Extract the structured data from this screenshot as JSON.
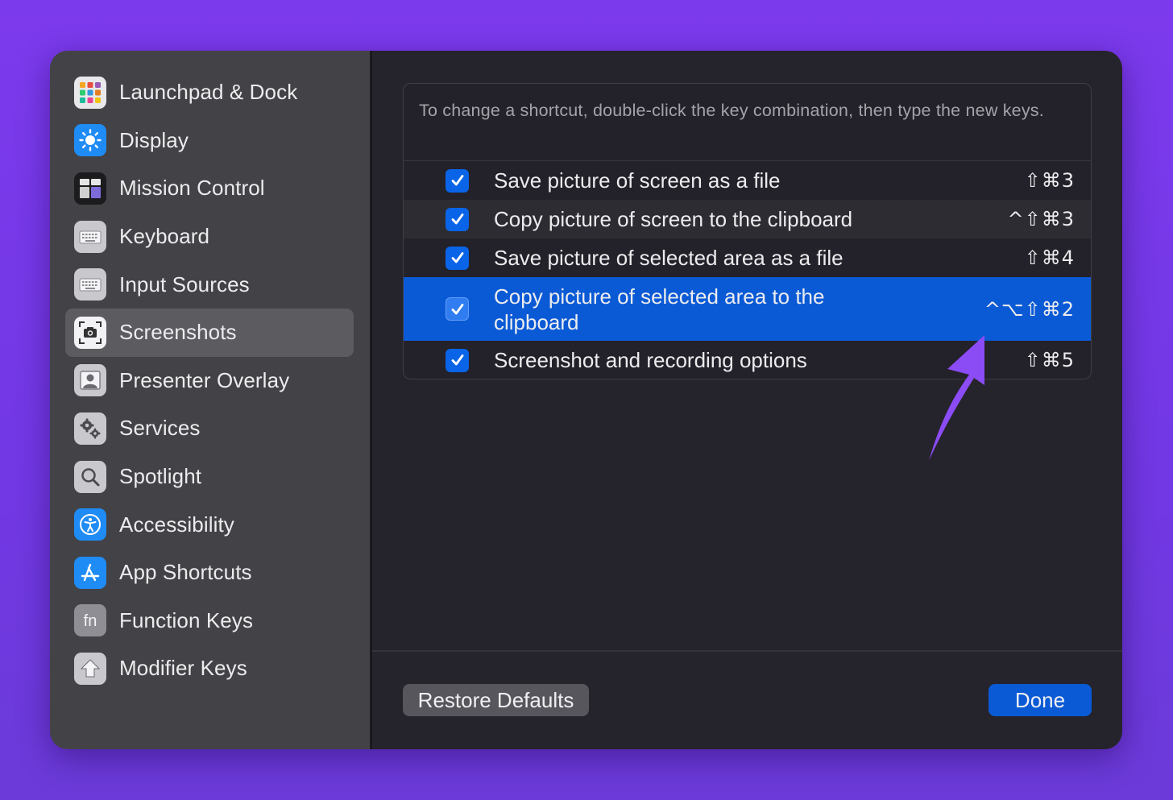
{
  "sidebar": {
    "items": [
      {
        "label": "Launchpad & Dock",
        "icon": "launchpad-icon"
      },
      {
        "label": "Display",
        "icon": "display-brightness-icon"
      },
      {
        "label": "Mission Control",
        "icon": "mission-control-icon"
      },
      {
        "label": "Keyboard",
        "icon": "keyboard-icon"
      },
      {
        "label": "Input Sources",
        "icon": "input-sources-icon"
      },
      {
        "label": "Screenshots",
        "icon": "screenshot-camera-icon",
        "selected": true
      },
      {
        "label": "Presenter Overlay",
        "icon": "presenter-overlay-icon"
      },
      {
        "label": "Services",
        "icon": "services-gears-icon"
      },
      {
        "label": "Spotlight",
        "icon": "spotlight-search-icon"
      },
      {
        "label": "Accessibility",
        "icon": "accessibility-icon"
      },
      {
        "label": "App Shortcuts",
        "icon": "app-shortcuts-icon"
      },
      {
        "label": "Function Keys",
        "icon": "function-keys-icon"
      },
      {
        "label": "Modifier Keys",
        "icon": "modifier-keys-icon"
      }
    ]
  },
  "panel": {
    "hint": "To change a shortcut, double-click the key combination, then type the new keys.",
    "shortcuts": [
      {
        "label": "Save picture of screen as a file",
        "keys": "⇧⌘3",
        "checked": true
      },
      {
        "label": "Copy picture of screen to the clipboard",
        "keys": "^⇧⌘3",
        "checked": true
      },
      {
        "label": "Save picture of selected area as a file",
        "keys": "⇧⌘4",
        "checked": true
      },
      {
        "label": "Copy picture of selected area to the clipboard",
        "keys": "^⌥⇧⌘2",
        "checked": true,
        "selected": true
      },
      {
        "label": "Screenshot and recording options",
        "keys": "⇧⌘5",
        "checked": true
      }
    ]
  },
  "footer": {
    "restore_label": "Restore Defaults",
    "done_label": "Done"
  },
  "colors": {
    "background": "#7c3aed",
    "accent": "#0a5ad6",
    "annotation_arrow": "#8b4cf6"
  }
}
